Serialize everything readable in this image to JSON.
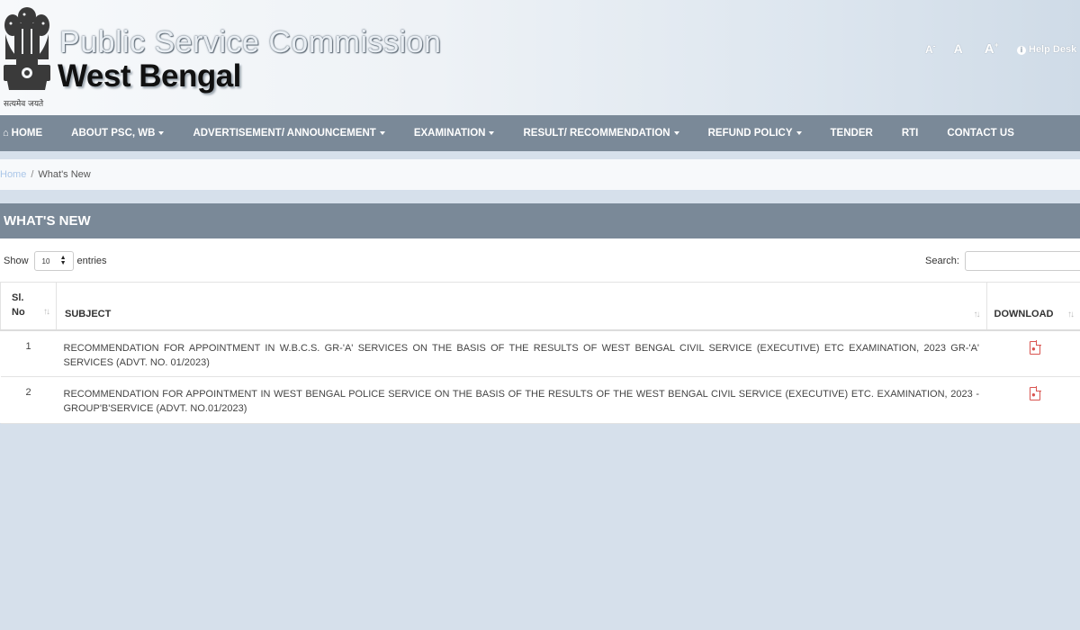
{
  "header": {
    "emblem_motto": "सत्यमेव जयते",
    "title_line1": "Public Service Commission",
    "title_line2": "West Bengal",
    "font_controls": {
      "decrease": "A",
      "decrease_sup": "-",
      "normal": "A",
      "increase": "A",
      "increase_sup": "+"
    },
    "help_desk": "Help Desk"
  },
  "nav": {
    "items": [
      {
        "label": "HOME",
        "icon": "home-icon"
      },
      {
        "label": "ABOUT PSC, WB",
        "dropdown": true
      },
      {
        "label": "ADVERTISEMENT/ ANNOUNCEMENT",
        "dropdown": true
      },
      {
        "label": "EXAMINATION",
        "dropdown": true
      },
      {
        "label": "RESULT/ RECOMMENDATION",
        "dropdown": true
      },
      {
        "label": "REFUND POLICY",
        "dropdown": true
      },
      {
        "label": "TENDER"
      },
      {
        "label": "RTI"
      },
      {
        "label": "CONTACT US"
      }
    ]
  },
  "breadcrumb": {
    "home": "Home",
    "separator": "/",
    "current": "What's New"
  },
  "panel": {
    "title": "WHAT'S NEW"
  },
  "table_controls": {
    "show_label": "Show",
    "entries_value": "10",
    "entries_label": "entries",
    "search_label": "Search:",
    "search_value": ""
  },
  "table": {
    "headers": {
      "sl_line1": "Sl.",
      "sl_line2": "No",
      "subject": "SUBJECT",
      "download": "DOWNLOAD"
    },
    "rows": [
      {
        "sl": "1",
        "subject": "RECOMMENDATION FOR APPOINTMENT IN W.B.C.S. GR-'A' SERVICES ON THE BASIS OF THE RESULTS OF WEST BENGAL CIVIL SERVICE (EXECUTIVE) ETC EXAMINATION, 2023 GR-'A' SERVICES (ADVT. NO. 01/2023)",
        "download_icon": "pdf-icon"
      },
      {
        "sl": "2",
        "subject": "RECOMMENDATION FOR APPOINTMENT IN WEST BENGAL POLICE SERVICE ON THE BASIS OF THE RESULTS OF THE WEST BENGAL CIVIL SERVICE (EXECUTIVE) ETC. EXAMINATION, 2023 - GROUP'B'SERVICE (ADVT. NO.01/2023)",
        "download_icon": "pdf-icon"
      }
    ]
  },
  "colors": {
    "nav_bg": "#7a8998",
    "page_bg": "#d6e0eb",
    "pdf_red": "#d9534f",
    "link": "#aac6e8"
  }
}
